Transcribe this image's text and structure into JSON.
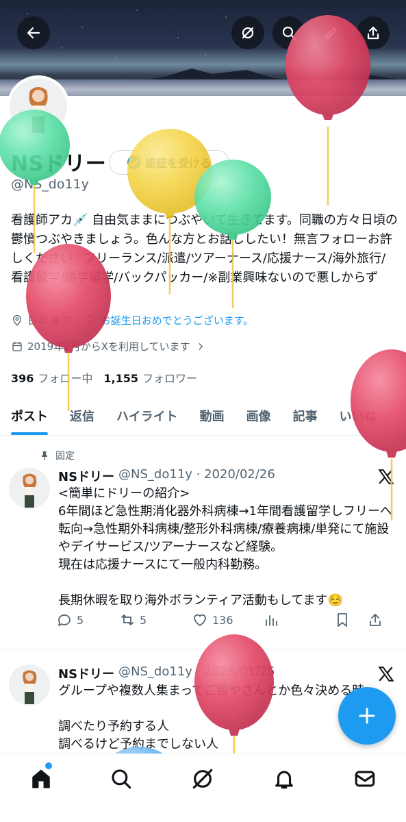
{
  "profile": {
    "name": "NSドリー",
    "handle": "@NS_do11y",
    "verify_label": "認証を受ける",
    "bio": "看護師アカ💉 自由気ままにつぶやいて生きてます。同職の方々日頃の鬱憤つぶやきましょう。色んな方とお話ししたい！無言フォローお許しください♡フリーランス/派遣/ツアーナース/応援ナース/海外旅行/看護留学/語学留学/バックパッカー/※副業興味ないので悪しからず",
    "location": "日本 東京",
    "birthday": "お誕生日おめでとうございます。",
    "joined": "2019年2月からXを利用しています",
    "following_count": "396",
    "following_label": "フォロー中",
    "followers_count": "1,155",
    "followers_label": "フォロワー"
  },
  "tabs": [
    {
      "label": "ポスト",
      "active": true
    },
    {
      "label": "返信"
    },
    {
      "label": "ハイライト"
    },
    {
      "label": "動画"
    },
    {
      "label": "画像"
    },
    {
      "label": "記事"
    },
    {
      "label": "いいね"
    }
  ],
  "tweets": [
    {
      "pinned_label": "固定",
      "name": "NSドリー",
      "meta": "@NS_do11y · 2020/02/26",
      "body": "<簡単にドリーの紹介>\n6年間ほど急性期消化器外科病棟→1年間看護留学しフリーへ転向→急性期外科病棟/整形外科病棟/療養病棟/単発にて施設やデイサービス/ツアーナースなど経験。\n現在は応援ナースにて一般内科勤務。\n\n長期休暇を取り海外ボランティア活動もしてます☺️",
      "replies": "5",
      "reposts": "5",
      "likes": "136"
    },
    {
      "name": "NSドリー",
      "meta": "@NS_do11y · 2026/01/25",
      "body": "グループや複数人集まってご飯やさんとか色々決める時\n\n調べたり予約する人\n調べるけど予約までしない人"
    }
  ],
  "colors": {
    "accent": "#1d9bf0",
    "balloon_red": "#e84a66",
    "balloon_green": "#5ee0a8",
    "balloon_yellow": "#f5d54a",
    "balloon_blue": "#6fb8f0"
  },
  "icons": {
    "header": [
      "back-arrow-icon",
      "grok-icon",
      "search-icon",
      "edit-icon",
      "share-icon"
    ],
    "nav": [
      "home-icon",
      "search-icon",
      "grok-icon",
      "notifications-icon",
      "messages-icon"
    ]
  }
}
